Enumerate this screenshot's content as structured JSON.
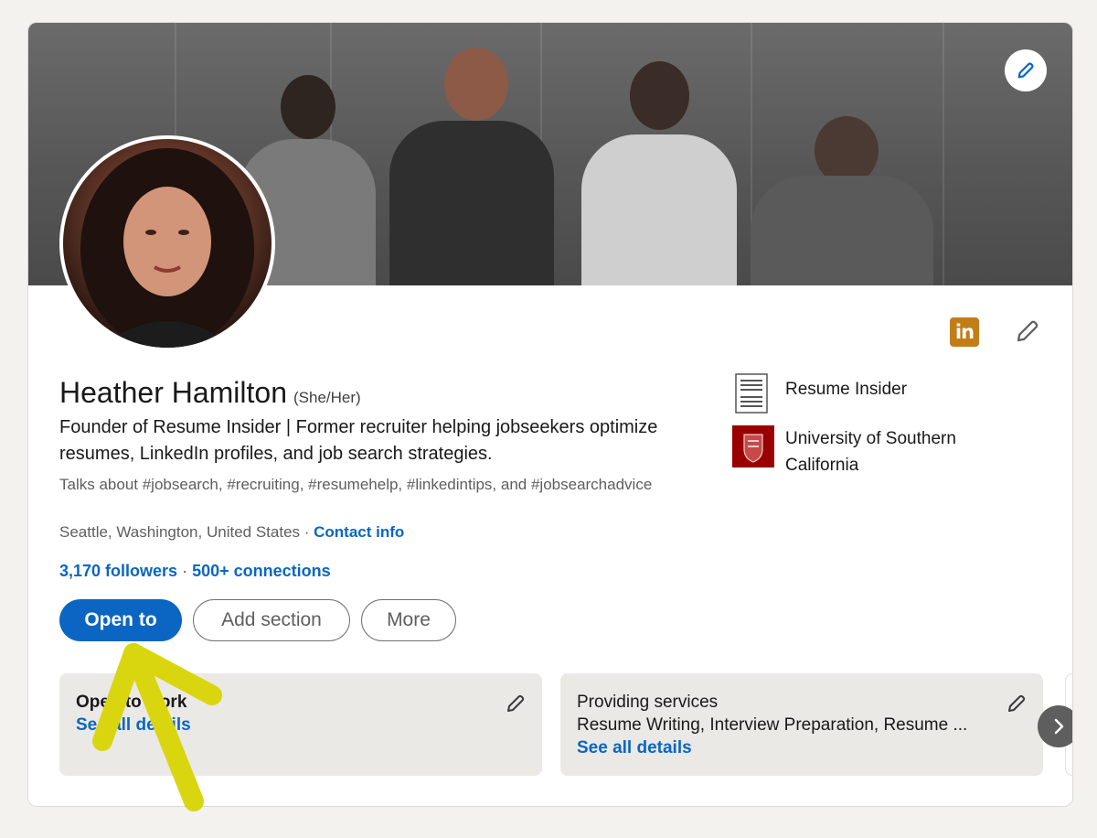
{
  "profile": {
    "name": "Heather Hamilton",
    "pronouns": "(She/Her)",
    "headline": "Founder of Resume Insider | Former recruiter helping jobseekers optimize resumes, LinkedIn profiles, and job search strategies.",
    "talks_about": "Talks about #jobsearch, #recruiting, #resumehelp, #linkedintips, and #jobsearchadvice",
    "location": "Seattle, Washington, United States",
    "location_separator": " · ",
    "contact_link": "Contact info",
    "followers": "3,170 followers",
    "stats_separator": " · ",
    "connections": "500+ connections"
  },
  "badge": {
    "text": "in"
  },
  "organizations": [
    {
      "name": "Resume Insider",
      "logo_text": "RESUME INSIDER"
    },
    {
      "name": "University of Southern California"
    }
  ],
  "actions": {
    "open_to": "Open to",
    "add_section": "Add section",
    "more": "More"
  },
  "cards": [
    {
      "title": "Open to work",
      "link": "See all details"
    },
    {
      "title": "Providing services",
      "text": "Resume Writing, Interview Preparation, Resume ...",
      "link": "See all details"
    }
  ],
  "colors": {
    "brand_blue": "#0a66c2",
    "badge_gold": "#c37d16",
    "usc_red": "#990000",
    "annotation_yellow": "#d9d60f"
  },
  "icons": [
    "pencil-icon",
    "linkedin-icon",
    "chevron-right-icon",
    "arrow-annotation"
  ]
}
